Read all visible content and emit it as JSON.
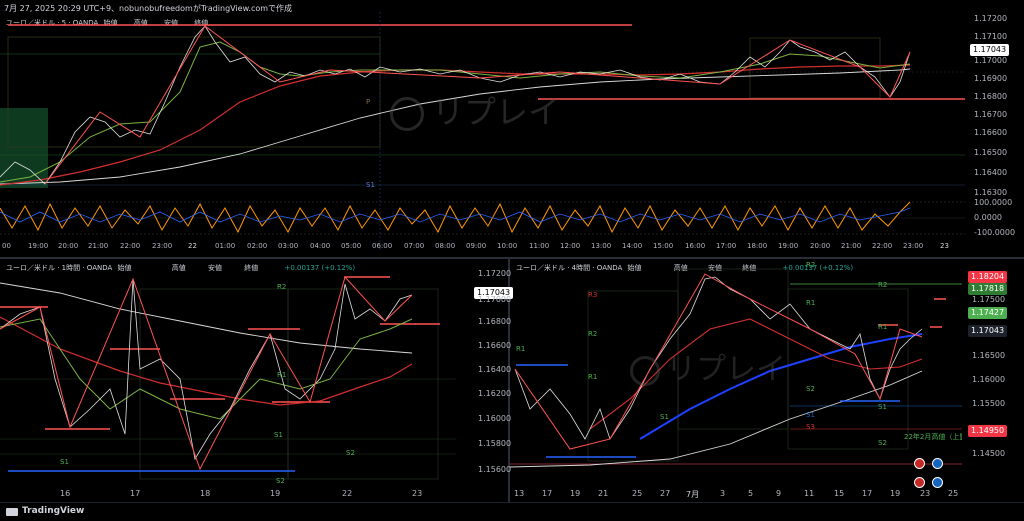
{
  "header": {
    "text": "7月 27, 2025 20:29 UTC+9、nobunobufreedomがTradingView.comで作成"
  },
  "top_chart": {
    "title": "ユーロ／米ドル · 5 · OANDA",
    "labels": [
      "始値",
      "高値",
      "安値",
      "終値"
    ],
    "price_tag": "1.17043",
    "price_axis": [
      "1.17200",
      "1.17100",
      "1.17000",
      "1.16900",
      "1.16800",
      "1.16700",
      "1.16600",
      "1.16500",
      "1.16400",
      "1.16300"
    ],
    "osc_axis": [
      "100.0000",
      "0.0000",
      "-100.0000"
    ],
    "time_axis": [
      "00",
      "19:00",
      "20:00",
      "21:00",
      "22:00",
      "23:00",
      "22",
      "01:00",
      "02:00",
      "03:00",
      "04:00",
      "05:00",
      "06:00",
      "07:00",
      "08:00",
      "09:00",
      "10:00",
      "11:00",
      "12:00",
      "13:00",
      "14:00",
      "15:00",
      "16:00",
      "17:00",
      "18:00",
      "19:00",
      "20:00",
      "21:00",
      "22:00",
      "23:00",
      "23"
    ],
    "watermark": "リプレイ",
    "s1_label": "S1",
    "p_label": "P"
  },
  "bottom_left": {
    "title": "ユーロ／米ドル · 1時間 · OANDA",
    "labels": [
      "始値",
      "高値",
      "安値",
      "終値"
    ],
    "change": "+0.00137 (+0.12%)",
    "price_tag": "1.17043",
    "price_axis": [
      "1.17200",
      "1.17000",
      "1.16800",
      "1.16600",
      "1.16400",
      "1.16200",
      "1.16000",
      "1.15800",
      "1.15600"
    ],
    "time_axis": [
      "16",
      "17",
      "18",
      "19",
      "22",
      "23"
    ],
    "pivots": [
      "R2",
      "R1",
      "S1",
      "S1",
      "S2",
      "S2"
    ]
  },
  "bottom_right": {
    "title": "ユーロ／米ドル · 4時間 · OANDA",
    "labels": [
      "始値",
      "高値",
      "安値",
      "終値"
    ],
    "change": "+0.00137 (+0.12%)",
    "price_axis": [
      "1.17500",
      "1.17000",
      "1.16500",
      "1.16000",
      "1.15500",
      "1.15000",
      "1.14500"
    ],
    "tags": [
      {
        "text": "1.18204",
        "color": "#f23645"
      },
      {
        "text": "1.17818",
        "color": "#2e7d32"
      },
      {
        "text": "1.17427",
        "color": "#4caf50"
      },
      {
        "text": "1.17043",
        "color": "#1e222d"
      },
      {
        "text": "1.14950",
        "color": "#f23645"
      }
    ],
    "time_axis": [
      "13",
      "17",
      "19",
      "21",
      "25",
      "27",
      "7月",
      "3",
      "5",
      "9",
      "11",
      "15",
      "17",
      "19",
      "23",
      "25"
    ],
    "pivots": [
      "R2",
      "R3",
      "R2",
      "R1",
      "R1",
      "P",
      "S1",
      "S2",
      "S3",
      "S1",
      "R2",
      "R1",
      "S1",
      "S2",
      "S3",
      "S1",
      "S2",
      "R1",
      "R2"
    ],
    "note": "22年2月高値（上髭）",
    "watermark": "リプレイ"
  },
  "footer": {
    "brand": "TradingView"
  }
}
